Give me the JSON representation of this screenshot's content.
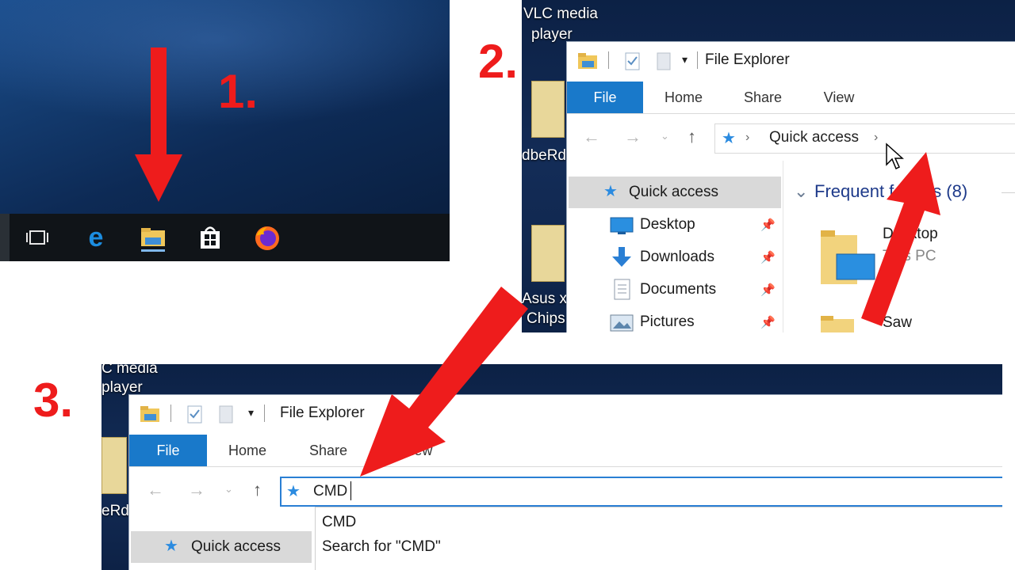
{
  "steps": {
    "one": "1.",
    "two": "2.",
    "three": "3."
  },
  "panel1": {
    "taskbar_icons": [
      "task-view-icon",
      "edge-icon",
      "file-explorer-icon",
      "store-icon",
      "firefox-icon"
    ]
  },
  "panel2": {
    "desktop": {
      "label_top_line1": "VLC media",
      "label_top_line2": "player",
      "label_mid": "dbeRd",
      "label_low_line1": "Asus x",
      "label_low_line2": "Chips"
    },
    "window_title": "File Explorer",
    "ribbon_tabs": [
      "File",
      "Home",
      "Share",
      "View"
    ],
    "address": {
      "location": "Quick access",
      "separator": "›"
    },
    "nav_pane": [
      {
        "label": "Quick access"
      },
      {
        "label": "Desktop"
      },
      {
        "label": "Downloads"
      },
      {
        "label": "Documents"
      },
      {
        "label": "Pictures"
      }
    ],
    "content": {
      "group_header": "Frequent folders (8)",
      "item1_name": "Desktop",
      "item1_sub": "This PC",
      "item2_name": "Saw"
    }
  },
  "panel3": {
    "desktop": {
      "label_top_line1": "C media",
      "label_top_line2": "player",
      "label_mid": "eRd"
    },
    "window_title": "File Explorer",
    "ribbon_tabs": [
      "File",
      "Home",
      "Share",
      "View"
    ],
    "address_value": "CMD",
    "suggestions": [
      "CMD",
      "Search for \"CMD\""
    ],
    "nav_pane": [
      {
        "label": "Quick access"
      }
    ]
  },
  "colors": {
    "accent": "#1979ca",
    "arrow_red": "#ee1c1c",
    "selection": "#d9d9d9"
  }
}
